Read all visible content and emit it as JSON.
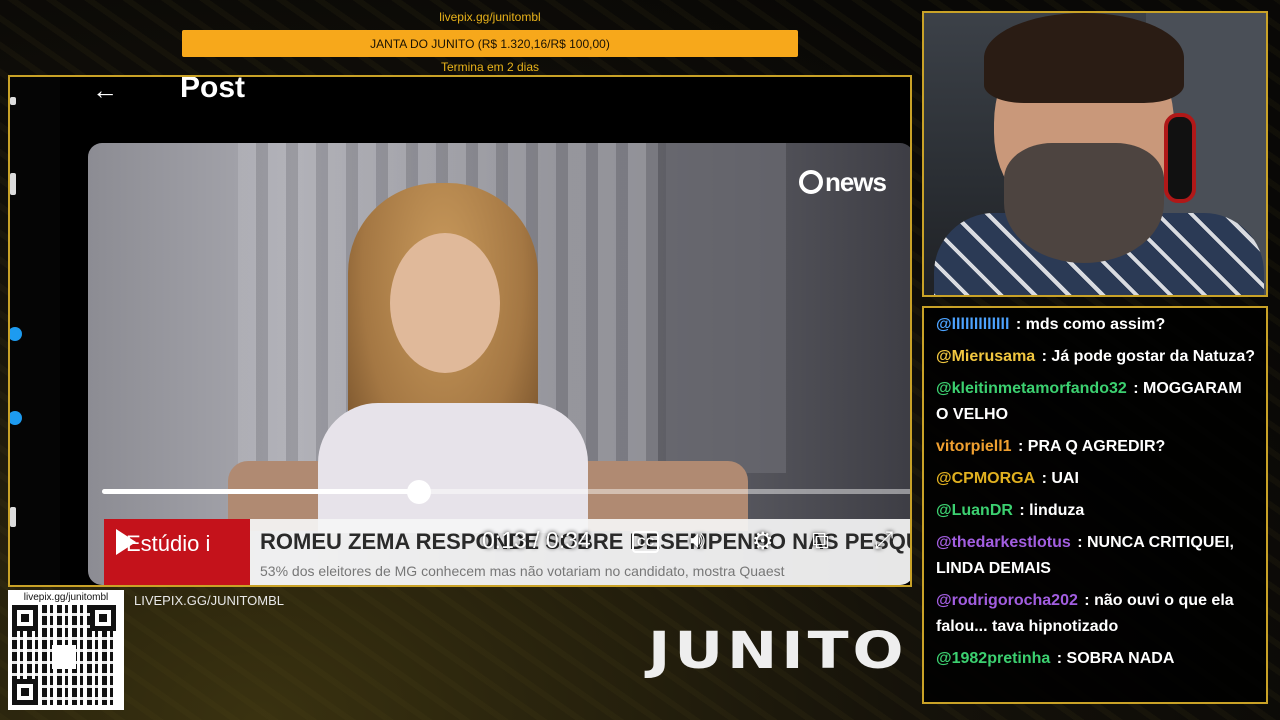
{
  "goal": {
    "url": "livepix.gg/junitombl",
    "label": "JANTA DO JUNITO (R$ 1.320,16/R$ 100,00)",
    "ends": "Termina em 2 dias",
    "accent": "#f7a81b"
  },
  "post": {
    "back_icon": "arrow-left-icon",
    "title": "Post"
  },
  "video": {
    "channel_logo": "news",
    "progress_fraction": 0.39,
    "timecode": "0:13 / 0:34",
    "lower_third": {
      "program": "Estúdio i",
      "headline": "ROMEU ZEMA RESPONDE SOBRE DESEMPENHO NAS PESQUISAS",
      "sub": "53% dos eleitores de MG conhecem mas não votariam no candidato, mostra Quaest"
    },
    "controls": [
      "play-icon",
      "cc-icon",
      "volume-icon",
      "gear-icon",
      "pip-icon",
      "fullscreen-icon"
    ]
  },
  "chat": {
    "messages": [
      {
        "user": "@lllllllllllll",
        "color": "#4da3ff",
        "text": ": mds como assim?"
      },
      {
        "user": "@Mierusama",
        "color": "#f0c640",
        "text": ": Já pode gostar da Natuza?"
      },
      {
        "user": "@kleitinmetamorfando32",
        "color": "#3cd070",
        "text": ": MOGGARAM O VELHO"
      },
      {
        "user": "vitorpiell1",
        "color": "#f0a030",
        "text": ": PRA Q AGREDIR?"
      },
      {
        "user": "@CPMORGA",
        "color": "#e0b020",
        "text": ": UAI"
      },
      {
        "user": "@LuanDR",
        "color": "#3cd070",
        "text": ": linduza"
      },
      {
        "user": "@thedarkestlotus",
        "color": "#a25ee0",
        "text": ": NUNCA CRITIQUEI, LINDA DEMAIS"
      },
      {
        "user": "@rodrigorocha202",
        "color": "#a25ee0",
        "text": ": não ouvi o que ela falou... tava hipnotizado"
      },
      {
        "user": "@1982pretinha",
        "color": "#3cd070",
        "text": ": SOBRA NADA"
      }
    ]
  },
  "footer": {
    "qr_label": "livepix.gg/junitombl",
    "url": "LIVEPIX.GG/JUNITOMBL",
    "brand": "JUNITO"
  }
}
